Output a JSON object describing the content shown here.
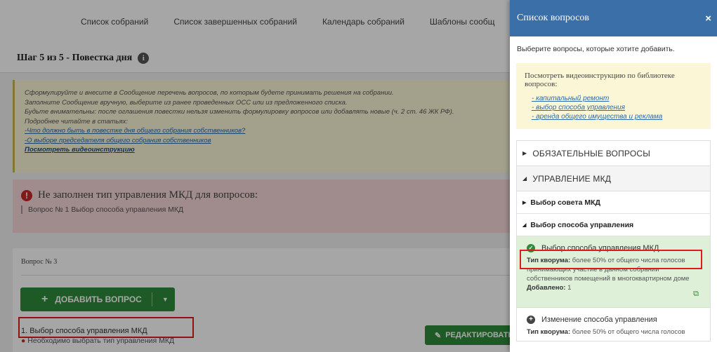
{
  "nav": {
    "items": [
      "Список собраний",
      "Список завершенных собраний",
      "Календарь собраний",
      "Шаблоны сообщ"
    ]
  },
  "step": {
    "title": "Шаг 5 из 5 - Повестка дня",
    "info_icon": "i"
  },
  "notice": {
    "line1": "Сформулируйте и внесите в Сообщение перечень вопросов, по которым будете принимать решения на собрании.",
    "line2": "Заполните Сообщение вручную, выберите из ранее проведенных ОСС или из предложенного списка.",
    "line3": "Будьте внимательны: после оглашения повестки нельзя изменить формулировку вопросов или добавлять новые (ч. 2 ст. 46 ЖК РФ).",
    "line4": "Подробнее читайте в статьях:",
    "link1": "-Что должно быть в повестке дня общего собрания собственников?",
    "link2": "-О выборе председателя общего собрания собственников",
    "video_link": "Посмотреть видеоинструкцию"
  },
  "error": {
    "title": "Не заполнен тип управления МКД для вопросов:",
    "detail": "Вопрос № 1 Выбор способа управления МКД",
    "icon": "!"
  },
  "questions": {
    "label": "Вопрос № 3",
    "add_button": "ДОБАВИТЬ ВОПРОС",
    "item": "1. Выбор способа управления МКД",
    "warning": "Необходимо выбрать тип управления МКД",
    "edit_button": "РЕДАКТИРОВАТЬ"
  },
  "panel": {
    "title": "Список вопросов",
    "close": "×",
    "hint": "Выберите вопросы, которые хотите добавить.",
    "video_title": "Посмотреть видеоинструкцию по библиотеке вопросов:",
    "video_links": [
      "- капитальный ремонт",
      "- выбор способа управления",
      "- аренда общего имущества и реклама"
    ],
    "section_required": "ОБЯЗАТЕЛЬНЫЕ ВОПРОСЫ",
    "section_management": "УПРАВЛЕНИЕ МКД",
    "sub_council": "Выбор совета МКД",
    "sub_method": "Выбор способа управления",
    "card1": {
      "name": "Выбор способа управления МКД",
      "quorum_label": "Тип кворума:",
      "quorum_text": "более 50% от общего числа голосов принимающих участие в данном собрании собственников помещений в многоквартирном доме",
      "added_label": "Добавлено:",
      "added_value": "1"
    },
    "card2": {
      "name": "Изменение способа управления",
      "quorum_label": "Тип кворума:",
      "quorum_text": "более 50% от общего числа голосов"
    }
  },
  "colors": {
    "panel_header": "#3a6fa8",
    "green": "#2e8b3a",
    "selected_bg": "#dff0d8",
    "highlight_frame": "#e01b1b"
  }
}
